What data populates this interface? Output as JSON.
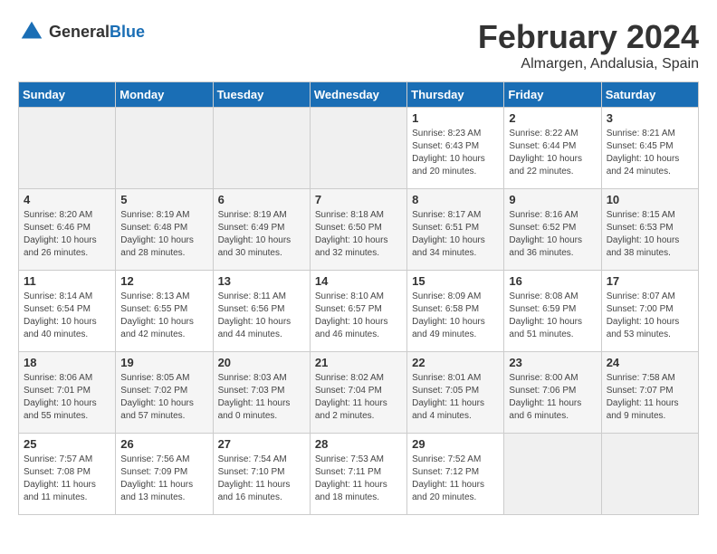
{
  "header": {
    "logo_general": "General",
    "logo_blue": "Blue",
    "month_title": "February 2024",
    "location": "Almargen, Andalusia, Spain"
  },
  "days_of_week": [
    "Sunday",
    "Monday",
    "Tuesday",
    "Wednesday",
    "Thursday",
    "Friday",
    "Saturday"
  ],
  "weeks": [
    [
      {
        "day": "",
        "info": ""
      },
      {
        "day": "",
        "info": ""
      },
      {
        "day": "",
        "info": ""
      },
      {
        "day": "",
        "info": ""
      },
      {
        "day": "1",
        "info": "Sunrise: 8:23 AM\nSunset: 6:43 PM\nDaylight: 10 hours\nand 20 minutes."
      },
      {
        "day": "2",
        "info": "Sunrise: 8:22 AM\nSunset: 6:44 PM\nDaylight: 10 hours\nand 22 minutes."
      },
      {
        "day": "3",
        "info": "Sunrise: 8:21 AM\nSunset: 6:45 PM\nDaylight: 10 hours\nand 24 minutes."
      }
    ],
    [
      {
        "day": "4",
        "info": "Sunrise: 8:20 AM\nSunset: 6:46 PM\nDaylight: 10 hours\nand 26 minutes."
      },
      {
        "day": "5",
        "info": "Sunrise: 8:19 AM\nSunset: 6:48 PM\nDaylight: 10 hours\nand 28 minutes."
      },
      {
        "day": "6",
        "info": "Sunrise: 8:19 AM\nSunset: 6:49 PM\nDaylight: 10 hours\nand 30 minutes."
      },
      {
        "day": "7",
        "info": "Sunrise: 8:18 AM\nSunset: 6:50 PM\nDaylight: 10 hours\nand 32 minutes."
      },
      {
        "day": "8",
        "info": "Sunrise: 8:17 AM\nSunset: 6:51 PM\nDaylight: 10 hours\nand 34 minutes."
      },
      {
        "day": "9",
        "info": "Sunrise: 8:16 AM\nSunset: 6:52 PM\nDaylight: 10 hours\nand 36 minutes."
      },
      {
        "day": "10",
        "info": "Sunrise: 8:15 AM\nSunset: 6:53 PM\nDaylight: 10 hours\nand 38 minutes."
      }
    ],
    [
      {
        "day": "11",
        "info": "Sunrise: 8:14 AM\nSunset: 6:54 PM\nDaylight: 10 hours\nand 40 minutes."
      },
      {
        "day": "12",
        "info": "Sunrise: 8:13 AM\nSunset: 6:55 PM\nDaylight: 10 hours\nand 42 minutes."
      },
      {
        "day": "13",
        "info": "Sunrise: 8:11 AM\nSunset: 6:56 PM\nDaylight: 10 hours\nand 44 minutes."
      },
      {
        "day": "14",
        "info": "Sunrise: 8:10 AM\nSunset: 6:57 PM\nDaylight: 10 hours\nand 46 minutes."
      },
      {
        "day": "15",
        "info": "Sunrise: 8:09 AM\nSunset: 6:58 PM\nDaylight: 10 hours\nand 49 minutes."
      },
      {
        "day": "16",
        "info": "Sunrise: 8:08 AM\nSunset: 6:59 PM\nDaylight: 10 hours\nand 51 minutes."
      },
      {
        "day": "17",
        "info": "Sunrise: 8:07 AM\nSunset: 7:00 PM\nDaylight: 10 hours\nand 53 minutes."
      }
    ],
    [
      {
        "day": "18",
        "info": "Sunrise: 8:06 AM\nSunset: 7:01 PM\nDaylight: 10 hours\nand 55 minutes."
      },
      {
        "day": "19",
        "info": "Sunrise: 8:05 AM\nSunset: 7:02 PM\nDaylight: 10 hours\nand 57 minutes."
      },
      {
        "day": "20",
        "info": "Sunrise: 8:03 AM\nSunset: 7:03 PM\nDaylight: 11 hours\nand 0 minutes."
      },
      {
        "day": "21",
        "info": "Sunrise: 8:02 AM\nSunset: 7:04 PM\nDaylight: 11 hours\nand 2 minutes."
      },
      {
        "day": "22",
        "info": "Sunrise: 8:01 AM\nSunset: 7:05 PM\nDaylight: 11 hours\nand 4 minutes."
      },
      {
        "day": "23",
        "info": "Sunrise: 8:00 AM\nSunset: 7:06 PM\nDaylight: 11 hours\nand 6 minutes."
      },
      {
        "day": "24",
        "info": "Sunrise: 7:58 AM\nSunset: 7:07 PM\nDaylight: 11 hours\nand 9 minutes."
      }
    ],
    [
      {
        "day": "25",
        "info": "Sunrise: 7:57 AM\nSunset: 7:08 PM\nDaylight: 11 hours\nand 11 minutes."
      },
      {
        "day": "26",
        "info": "Sunrise: 7:56 AM\nSunset: 7:09 PM\nDaylight: 11 hours\nand 13 minutes."
      },
      {
        "day": "27",
        "info": "Sunrise: 7:54 AM\nSunset: 7:10 PM\nDaylight: 11 hours\nand 16 minutes."
      },
      {
        "day": "28",
        "info": "Sunrise: 7:53 AM\nSunset: 7:11 PM\nDaylight: 11 hours\nand 18 minutes."
      },
      {
        "day": "29",
        "info": "Sunrise: 7:52 AM\nSunset: 7:12 PM\nDaylight: 11 hours\nand 20 minutes."
      },
      {
        "day": "",
        "info": ""
      },
      {
        "day": "",
        "info": ""
      }
    ]
  ]
}
